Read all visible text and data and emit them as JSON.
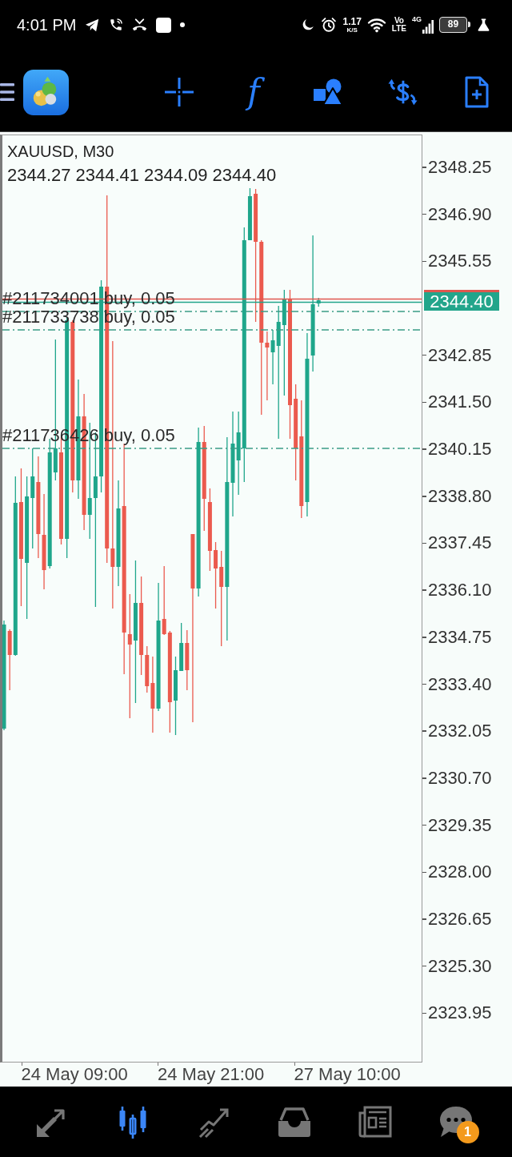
{
  "status_bar": {
    "time": "4:01 PM",
    "network_speed": "1.17",
    "network_speed_unit": "K/S",
    "volte": [
      "Vo",
      "LTE"
    ],
    "network_type": "4G",
    "battery": "89"
  },
  "toolbar": {
    "function_label": "f"
  },
  "chart": {
    "symbol": "XAUUSD, M30",
    "ohlc": [
      "2344.27",
      "2344.41",
      "2344.09",
      "2344.40"
    ],
    "orders": [
      {
        "label": "#211734001 buy, 0.05"
      },
      {
        "label": "#211733738 buy, 0.05"
      },
      {
        "label": "#211736426 buy, 0.05"
      }
    ],
    "price_axis_above": [
      "2348.25",
      "2346.90",
      "2345.55"
    ],
    "price_tag": "2344.40",
    "price_axis_below": [
      "2342.85",
      "2341.50",
      "2340.15",
      "2338.80",
      "2337.45",
      "2336.10",
      "2334.75",
      "2333.40",
      "2332.05",
      "2330.70",
      "2329.35",
      "2328.00",
      "2326.65",
      "2325.30",
      "2323.95"
    ],
    "time_axis": [
      "24 May 09:00",
      "24 May 21:00",
      "27 May 10:00"
    ]
  },
  "bottom_nav": [
    {
      "kind": "quotes",
      "selected": false
    },
    {
      "kind": "chart",
      "selected": true
    },
    {
      "kind": "trade",
      "selected": false
    },
    {
      "kind": "history",
      "selected": false
    },
    {
      "kind": "news",
      "selected": false
    },
    {
      "kind": "chat",
      "selected": false,
      "badge": "1"
    }
  ]
}
